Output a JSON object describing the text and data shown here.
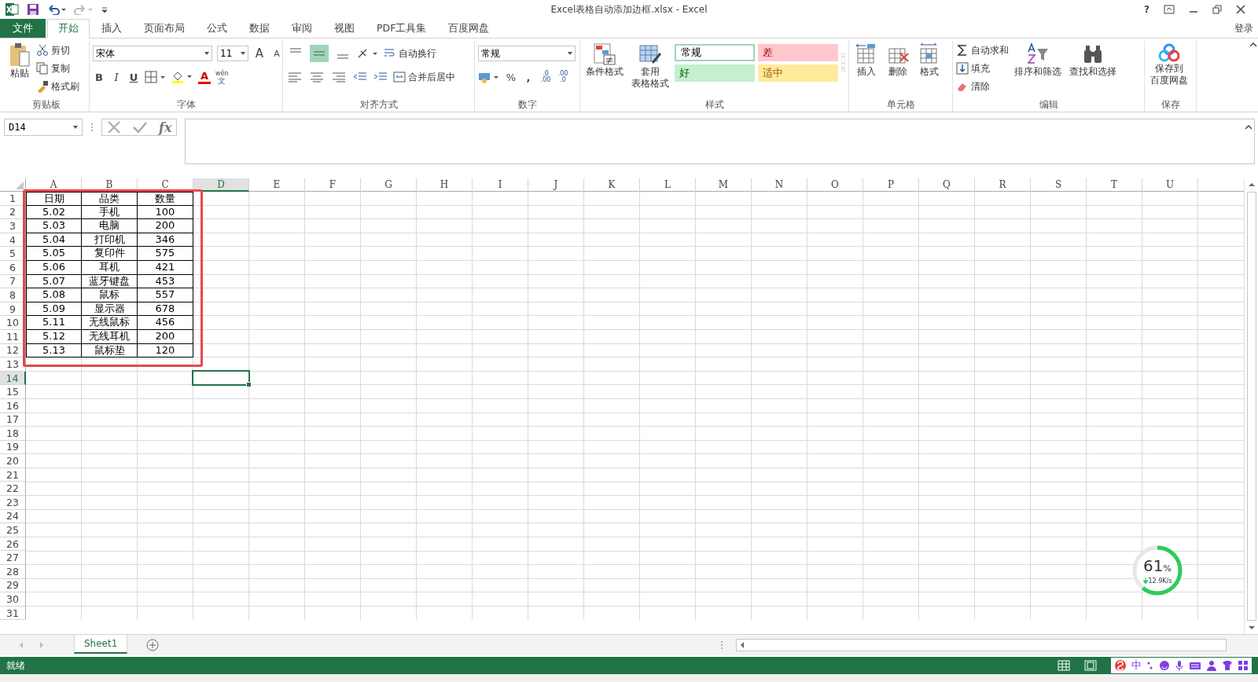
{
  "window": {
    "title": "Excel表格自动添加边框.xlsx - Excel",
    "help": "?",
    "account": "登录"
  },
  "tabs": [
    {
      "label": "文件",
      "kind": "file",
      "selected": false
    },
    {
      "label": "开始",
      "kind": "tab",
      "selected": true
    },
    {
      "label": "插入",
      "kind": "tab",
      "selected": false
    },
    {
      "label": "页面布局",
      "kind": "tab",
      "selected": false
    },
    {
      "label": "公式",
      "kind": "tab",
      "selected": false
    },
    {
      "label": "数据",
      "kind": "tab",
      "selected": false
    },
    {
      "label": "审阅",
      "kind": "tab",
      "selected": false
    },
    {
      "label": "视图",
      "kind": "tab",
      "selected": false
    },
    {
      "label": "PDF工具集",
      "kind": "tab",
      "selected": false
    },
    {
      "label": "百度网盘",
      "kind": "tab",
      "selected": false
    }
  ],
  "ribbon": {
    "clipboard": {
      "label": "剪贴板",
      "paste": "粘贴",
      "cut": "剪切",
      "copy": "复制",
      "painter": "格式刷"
    },
    "font": {
      "label": "字体",
      "name": "宋体",
      "size": "11",
      "grow": "A",
      "shrink": "A",
      "bold": "B",
      "italic": "I",
      "underline": "U",
      "font_color": "A",
      "phonetic": "wén",
      "phonetic_char": "文"
    },
    "alignment": {
      "label": "对齐方式",
      "wrap": "自动换行",
      "merge": "合并后居中"
    },
    "number": {
      "label": "数字",
      "format": "常规",
      "percent": "%",
      "comma": ",",
      "increase": [
        ".0",
        ".00"
      ],
      "decrease": [
        ".00",
        ".0"
      ]
    },
    "styles": {
      "label": "样式",
      "conditional": "条件格式",
      "table_format": [
        "套用",
        "表格格式"
      ],
      "presets": [
        {
          "label": "常规",
          "kind": "normal",
          "color": "#ffffff"
        },
        {
          "label": "差",
          "kind": "bad",
          "color": "#ffc7ce"
        },
        {
          "label": "好",
          "kind": "good",
          "color": "#c6efce"
        },
        {
          "label": "适中",
          "kind": "neutral",
          "color": "#ffeb9c"
        }
      ]
    },
    "cells": {
      "label": "单元格",
      "insert": "插入",
      "delete": "删除",
      "format": "格式"
    },
    "editing": {
      "label": "编辑",
      "autosum": "自动求和",
      "fill": "填充",
      "clear": "清除",
      "sort": "排序和筛选",
      "find": "查找和选择"
    },
    "save": {
      "label": "保存",
      "button": [
        "保存到",
        "百度网盘"
      ]
    }
  },
  "formula_bar": {
    "name_box": "D14",
    "fx": "fx"
  },
  "sheet": {
    "highlight_frame": true,
    "columns": [
      {
        "label": "A",
        "selected": false
      },
      {
        "label": "B",
        "selected": false
      },
      {
        "label": "C",
        "selected": false
      },
      {
        "label": "D",
        "selected": true
      },
      {
        "label": "E",
        "selected": false
      },
      {
        "label": "F",
        "selected": false
      },
      {
        "label": "G",
        "selected": false
      },
      {
        "label": "H",
        "selected": false
      },
      {
        "label": "I",
        "selected": false
      },
      {
        "label": "J",
        "selected": false
      },
      {
        "label": "K",
        "selected": false
      },
      {
        "label": "L",
        "selected": false
      },
      {
        "label": "M",
        "selected": false
      },
      {
        "label": "N",
        "selected": false
      },
      {
        "label": "O",
        "selected": false
      },
      {
        "label": "P",
        "selected": false
      },
      {
        "label": "Q",
        "selected": false
      },
      {
        "label": "R",
        "selected": false
      },
      {
        "label": "S",
        "selected": false
      },
      {
        "label": "T",
        "selected": false
      },
      {
        "label": "U",
        "selected": false
      }
    ],
    "rows": [
      {
        "number": "1",
        "selected": false,
        "cells": [
          "日期",
          "品类",
          "数量"
        ]
      },
      {
        "number": "2",
        "selected": false,
        "cells": [
          "5.02",
          "手机",
          "100"
        ]
      },
      {
        "number": "3",
        "selected": false,
        "cells": [
          "5.03",
          "电脑",
          "200"
        ]
      },
      {
        "number": "4",
        "selected": false,
        "cells": [
          "5.04",
          "打印机",
          "346"
        ]
      },
      {
        "number": "5",
        "selected": false,
        "cells": [
          "5.05",
          "复印件",
          "575"
        ]
      },
      {
        "number": "6",
        "selected": false,
        "cells": [
          "5.06",
          "耳机",
          "421"
        ]
      },
      {
        "number": "7",
        "selected": false,
        "cells": [
          "5.07",
          "蓝牙键盘",
          "453"
        ]
      },
      {
        "number": "8",
        "selected": false,
        "cells": [
          "5.08",
          "鼠标",
          "557"
        ]
      },
      {
        "number": "9",
        "selected": false,
        "cells": [
          "5.09",
          "显示器",
          "678"
        ]
      },
      {
        "number": "10",
        "selected": false,
        "cells": [
          "5.11",
          "无线鼠标",
          "456"
        ]
      },
      {
        "number": "11",
        "selected": false,
        "cells": [
          "5.12",
          "无线耳机",
          "200"
        ]
      },
      {
        "number": "12",
        "selected": false,
        "cells": [
          "5.13",
          "鼠标垫",
          "120"
        ]
      },
      {
        "number": "13",
        "selected": false
      },
      {
        "number": "14",
        "selected": true
      },
      {
        "number": "15",
        "selected": false
      },
      {
        "number": "16",
        "selected": false
      },
      {
        "number": "17",
        "selected": false
      },
      {
        "number": "18",
        "selected": false
      },
      {
        "number": "19",
        "selected": false
      },
      {
        "number": "20",
        "selected": false
      },
      {
        "number": "21",
        "selected": false
      },
      {
        "number": "22",
        "selected": false
      },
      {
        "number": "23",
        "selected": false
      },
      {
        "number": "24",
        "selected": false
      },
      {
        "number": "25",
        "selected": false
      },
      {
        "number": "26",
        "selected": false
      },
      {
        "number": "27",
        "selected": false
      },
      {
        "number": "28",
        "selected": false
      },
      {
        "number": "29",
        "selected": false
      },
      {
        "number": "30",
        "selected": false
      },
      {
        "number": "31",
        "selected": false
      }
    ]
  },
  "sheet_tabs": [
    {
      "label": "Sheet1",
      "selected": true
    }
  ],
  "status_bar": {
    "text": "就绪",
    "ime": "中"
  },
  "speed_widget": {
    "percent": "61",
    "unit": "%",
    "speed": "12.9K/s",
    "level": 0.61
  }
}
